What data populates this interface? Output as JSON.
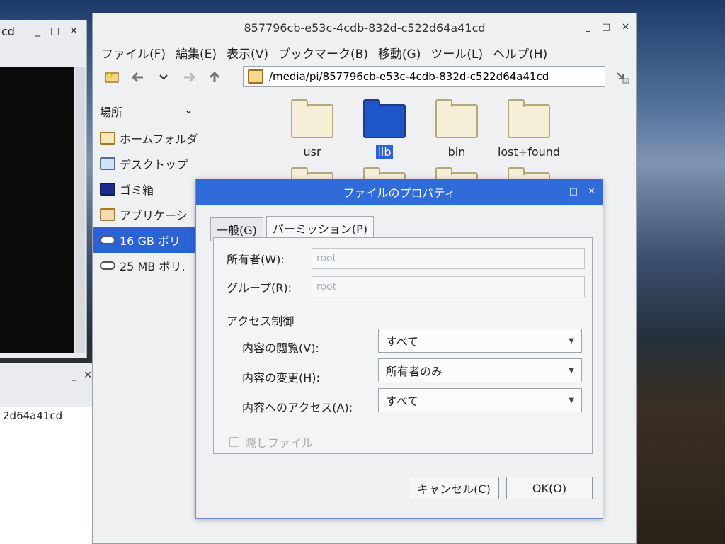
{
  "bg_windows": {
    "left_top_title": "cd",
    "left_bottom_text": "2d64a41cd"
  },
  "window_controls": {
    "minimize": "_",
    "maximize": "□",
    "close": "✕"
  },
  "file_manager": {
    "title": "857796cb-e53c-4cdb-832d-c522d64a41cd",
    "menu": [
      "ファイル(F)",
      "編集(E)",
      "表示(V)",
      "ブックマーク(B)",
      "移動(G)",
      "ツール(L)",
      "ヘルプ(H)"
    ],
    "path": "/media/pi/857796cb-e53c-4cdb-832d-c522d64a41cd",
    "sidebar": {
      "header": "場所",
      "items": [
        {
          "label": "ホームフォルダ",
          "icon": "home-icon"
        },
        {
          "label": "デスクトップ",
          "icon": "desktop-icon"
        },
        {
          "label": "ゴミ箱",
          "icon": "trash-icon"
        },
        {
          "label": "アプリケーシ",
          "icon": "applications-icon"
        },
        {
          "label": "16 GB ボリ",
          "icon": "drive-icon",
          "selected": true
        },
        {
          "label": "25 MB ボリ.",
          "icon": "drive-icon"
        }
      ]
    },
    "files": [
      {
        "name": "usr"
      },
      {
        "name": "lib",
        "selected": true
      },
      {
        "name": "bin"
      },
      {
        "name": "lost+found"
      }
    ]
  },
  "dialog": {
    "title": "ファイルのプロパティ",
    "tabs": [
      "一般(G)",
      "パーミッション(P)"
    ],
    "owner_label": "所有者(W):",
    "owner_value": "root",
    "group_label": "グループ(R):",
    "group_value": "root",
    "access_heading": "アクセス制御",
    "view_label": "内容の閲覧(V):",
    "view_value": "すべて",
    "change_label": "内容の変更(H):",
    "change_value": "所有者のみ",
    "access_label": "内容へのアクセス(A):",
    "access_value": "すべて",
    "hidden_label": "隠しファイル",
    "cancel": "キャンセル(C)",
    "ok": "OK(O)"
  }
}
